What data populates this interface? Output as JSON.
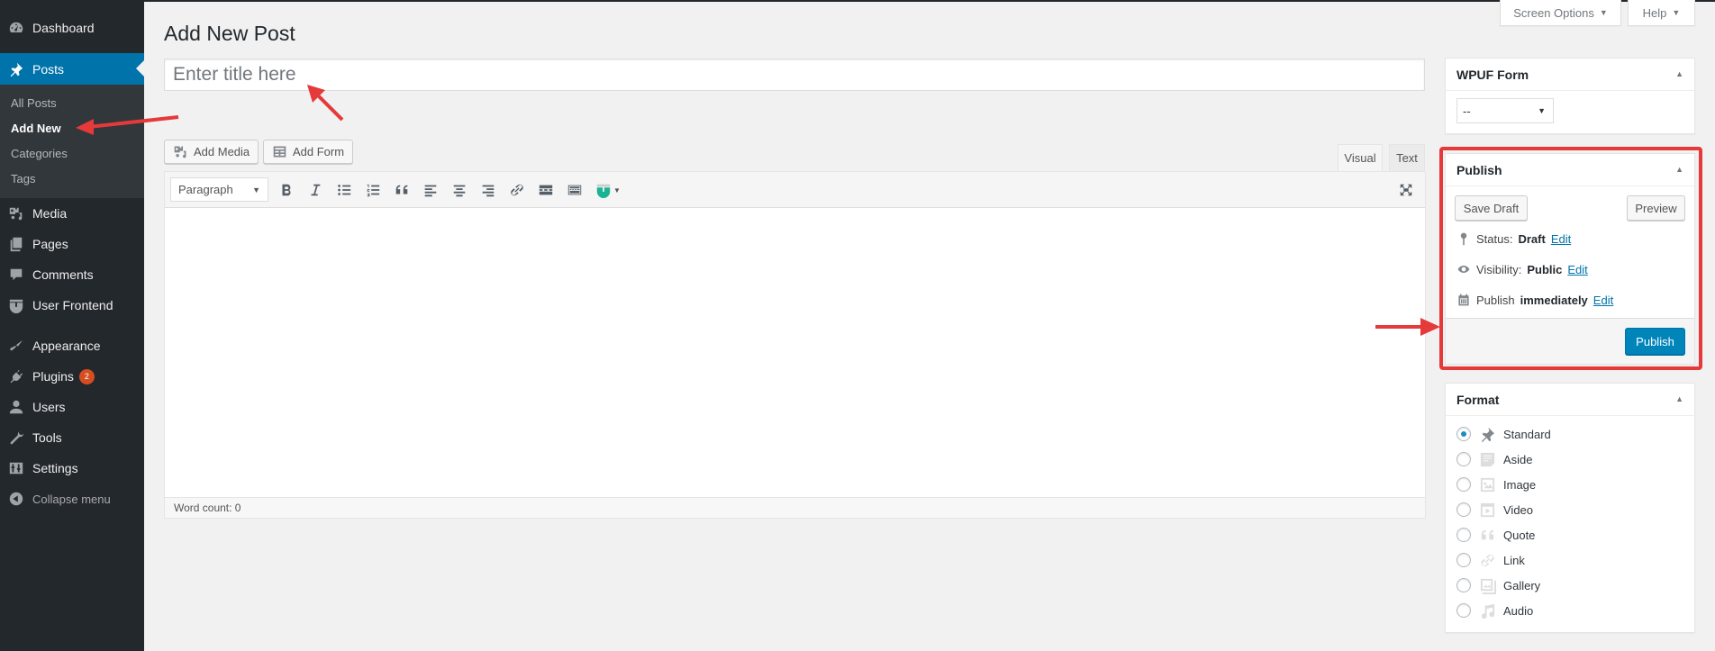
{
  "sidebar": {
    "items": [
      {
        "label": "Dashboard",
        "icon": "dashboard-icon"
      },
      {
        "label": "Posts",
        "icon": "pin-icon",
        "active": true
      },
      {
        "label": "Media",
        "icon": "media-icon"
      },
      {
        "label": "Pages",
        "icon": "pages-icon"
      },
      {
        "label": "Comments",
        "icon": "comment-icon"
      },
      {
        "label": "User Frontend",
        "icon": "user-frontend-icon"
      },
      {
        "label": "Appearance",
        "icon": "paintbrush-icon"
      },
      {
        "label": "Plugins",
        "icon": "plugin-icon",
        "badge": "2"
      },
      {
        "label": "Users",
        "icon": "user-icon"
      },
      {
        "label": "Tools",
        "icon": "wrench-icon"
      },
      {
        "label": "Settings",
        "icon": "settings-icon"
      }
    ],
    "submenu": [
      {
        "label": "All Posts"
      },
      {
        "label": "Add New",
        "current": true
      },
      {
        "label": "Categories"
      },
      {
        "label": "Tags"
      }
    ],
    "collapse_label": "Collapse menu"
  },
  "header": {
    "screen_options": "Screen Options",
    "help": "Help",
    "page_title": "Add New Post"
  },
  "title_input": {
    "placeholder": "Enter title here",
    "value": ""
  },
  "media_buttons": {
    "add_media": "Add Media",
    "add_form": "Add Form"
  },
  "editor": {
    "tabs": [
      {
        "label": "Visual",
        "active": true
      },
      {
        "label": "Text"
      }
    ],
    "format_select": "Paragraph",
    "toolbar": [
      "bold",
      "italic",
      "bulleted-list",
      "numbered-list",
      "blockquote",
      "align-left",
      "align-center",
      "align-right",
      "insert-link",
      "read-more",
      "toolbar-toggle",
      "wpuf-shortcode"
    ],
    "word_count": "Word count: 0"
  },
  "wpuf_box": {
    "title": "WPUF Form",
    "selected": "--"
  },
  "publish_box": {
    "title": "Publish",
    "save_draft": "Save Draft",
    "preview": "Preview",
    "status_label": "Status:",
    "status_value": "Draft",
    "visibility_label": "Visibility:",
    "visibility_value": "Public",
    "publish_label": "Publish",
    "publish_value": "immediately",
    "edit": "Edit",
    "publish_button": "Publish"
  },
  "format_box": {
    "title": "Format",
    "options": [
      {
        "label": "Standard",
        "checked": true
      },
      {
        "label": "Aside"
      },
      {
        "label": "Image"
      },
      {
        "label": "Video"
      },
      {
        "label": "Quote"
      },
      {
        "label": "Link"
      },
      {
        "label": "Gallery"
      },
      {
        "label": "Audio"
      }
    ]
  },
  "colors": {
    "sidebar_bg": "#23282d",
    "accent": "#0073aa",
    "publish_button": "#0085ba",
    "annotation_red": "#e5393a",
    "badge": "#d54e21"
  }
}
